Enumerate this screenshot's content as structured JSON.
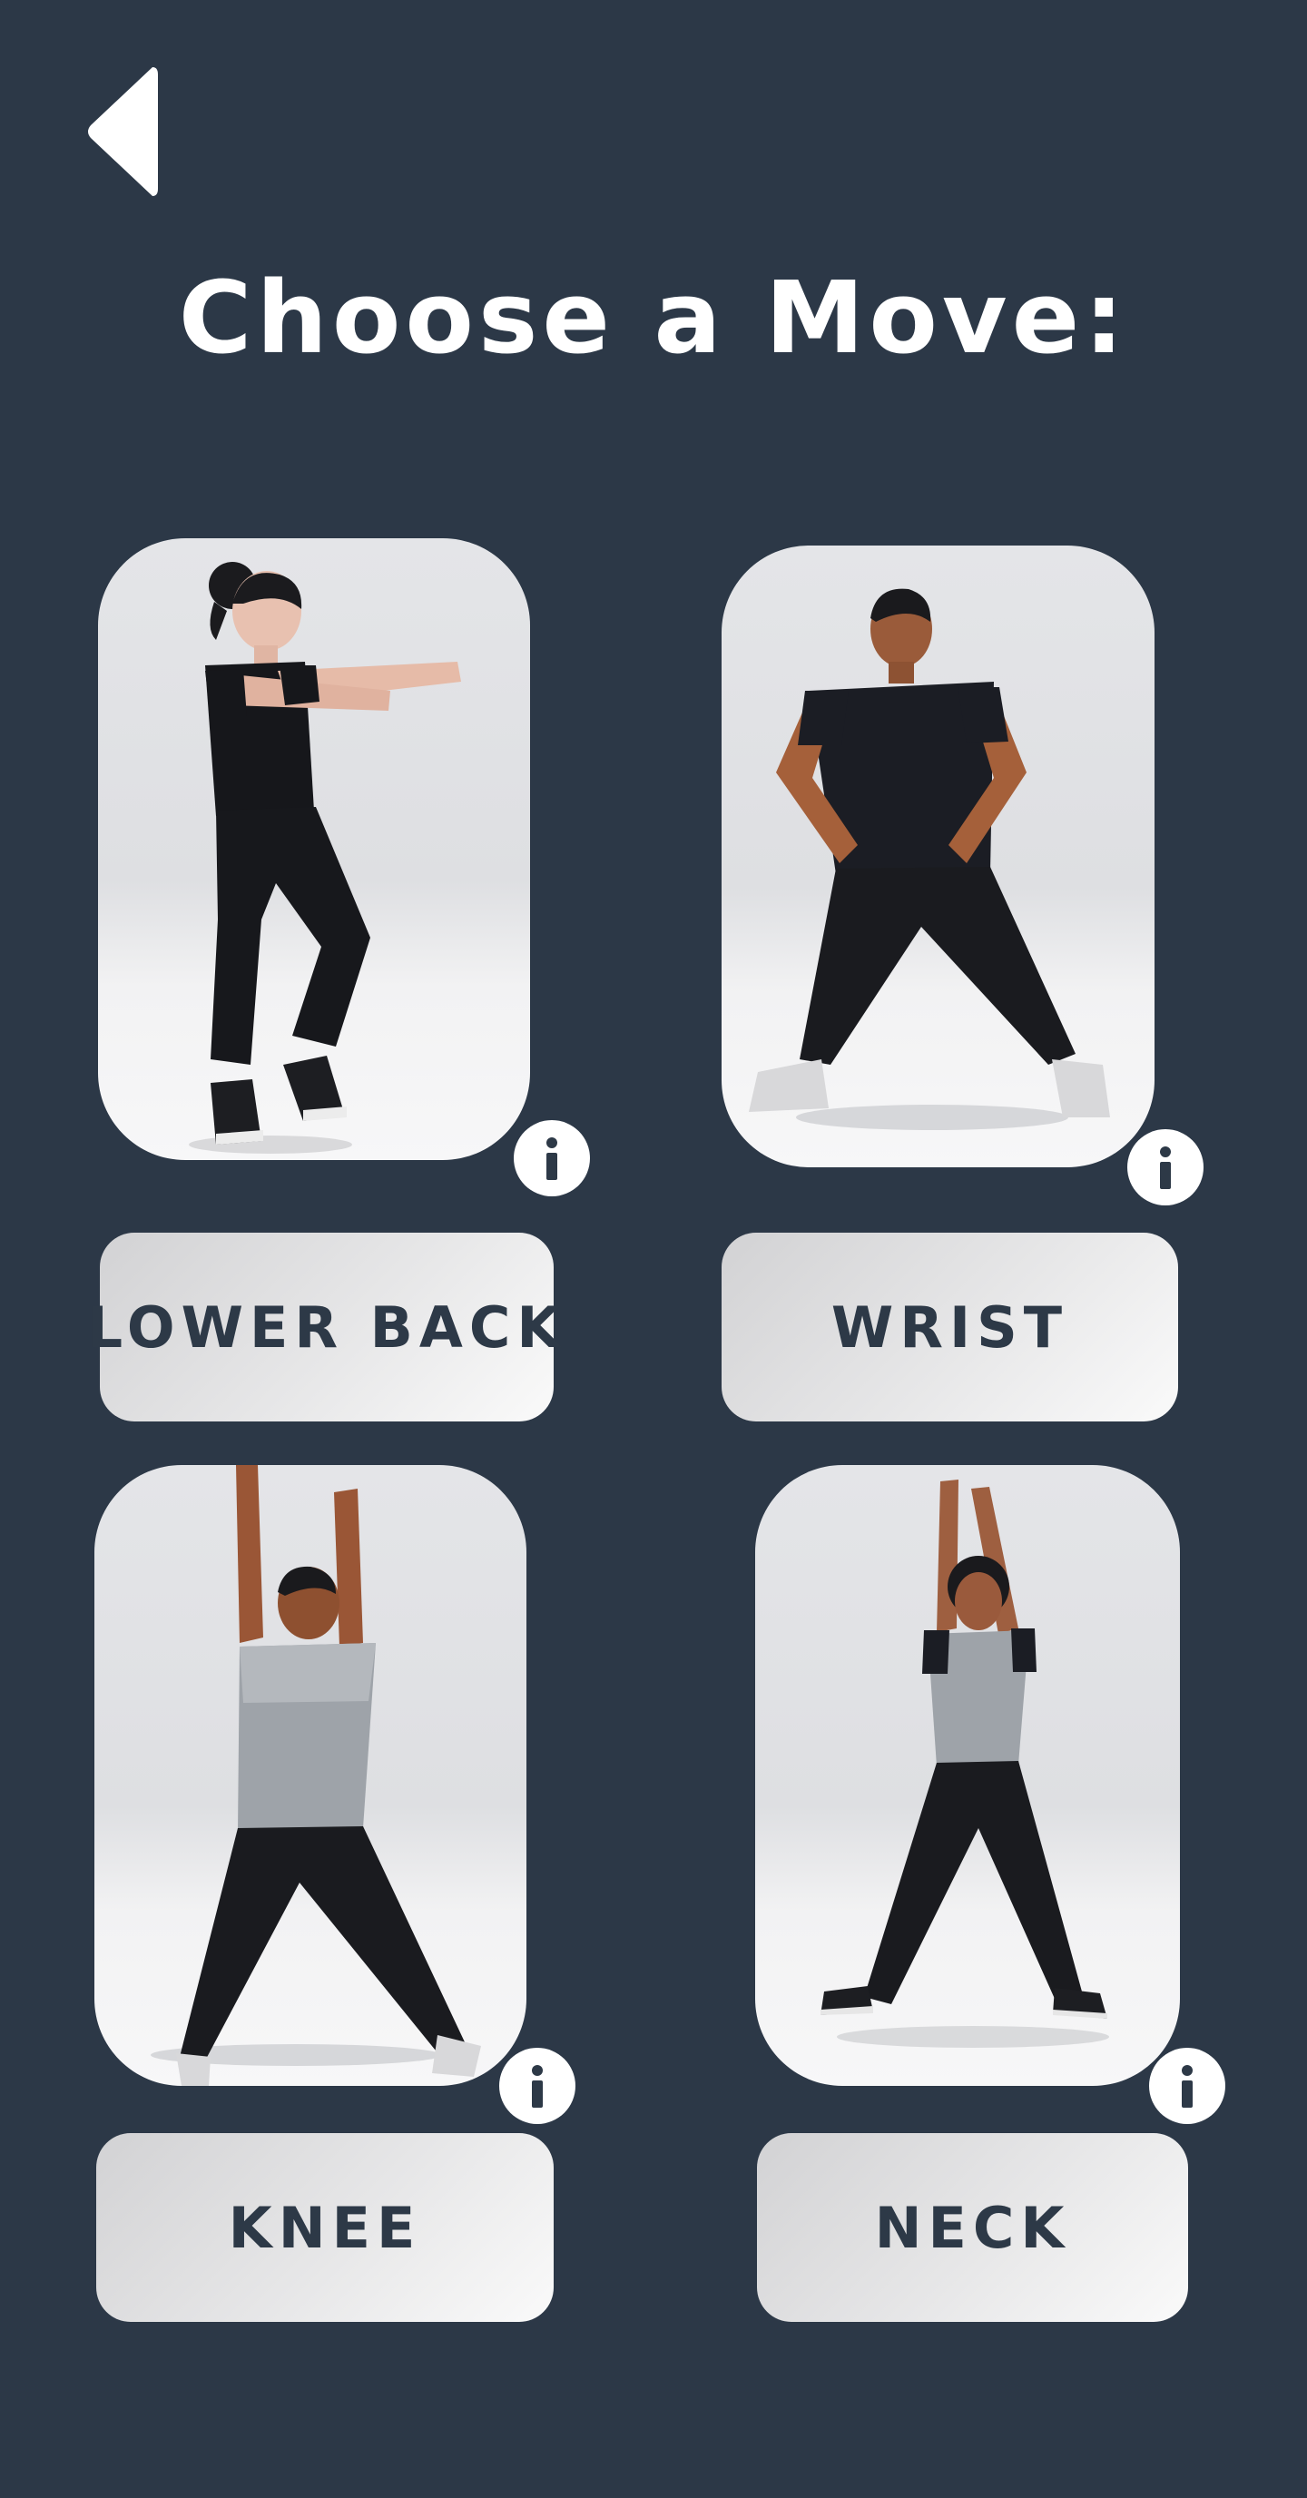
{
  "header": {
    "title": "Choose a Move:",
    "back_icon": "back-triangle-icon"
  },
  "moves": [
    {
      "label": "LOWER BACK",
      "avatar": "woman-squat-arms-forward",
      "info_icon": "info-icon"
    },
    {
      "label": "WRIST",
      "avatar": "man-wide-stance-hands-on-hips",
      "info_icon": "info-icon"
    },
    {
      "label": "KNEE",
      "avatar": "man-jumping-jack-arms-up",
      "info_icon": "info-icon"
    },
    {
      "label": "NECK",
      "avatar": "woman-jumping-jack-arms-up",
      "info_icon": "info-icon"
    }
  ],
  "colors": {
    "background": "#2c3847",
    "label_text": "#2d3947",
    "card_background": "#e4e5e8",
    "info_background": "#ffffff"
  }
}
